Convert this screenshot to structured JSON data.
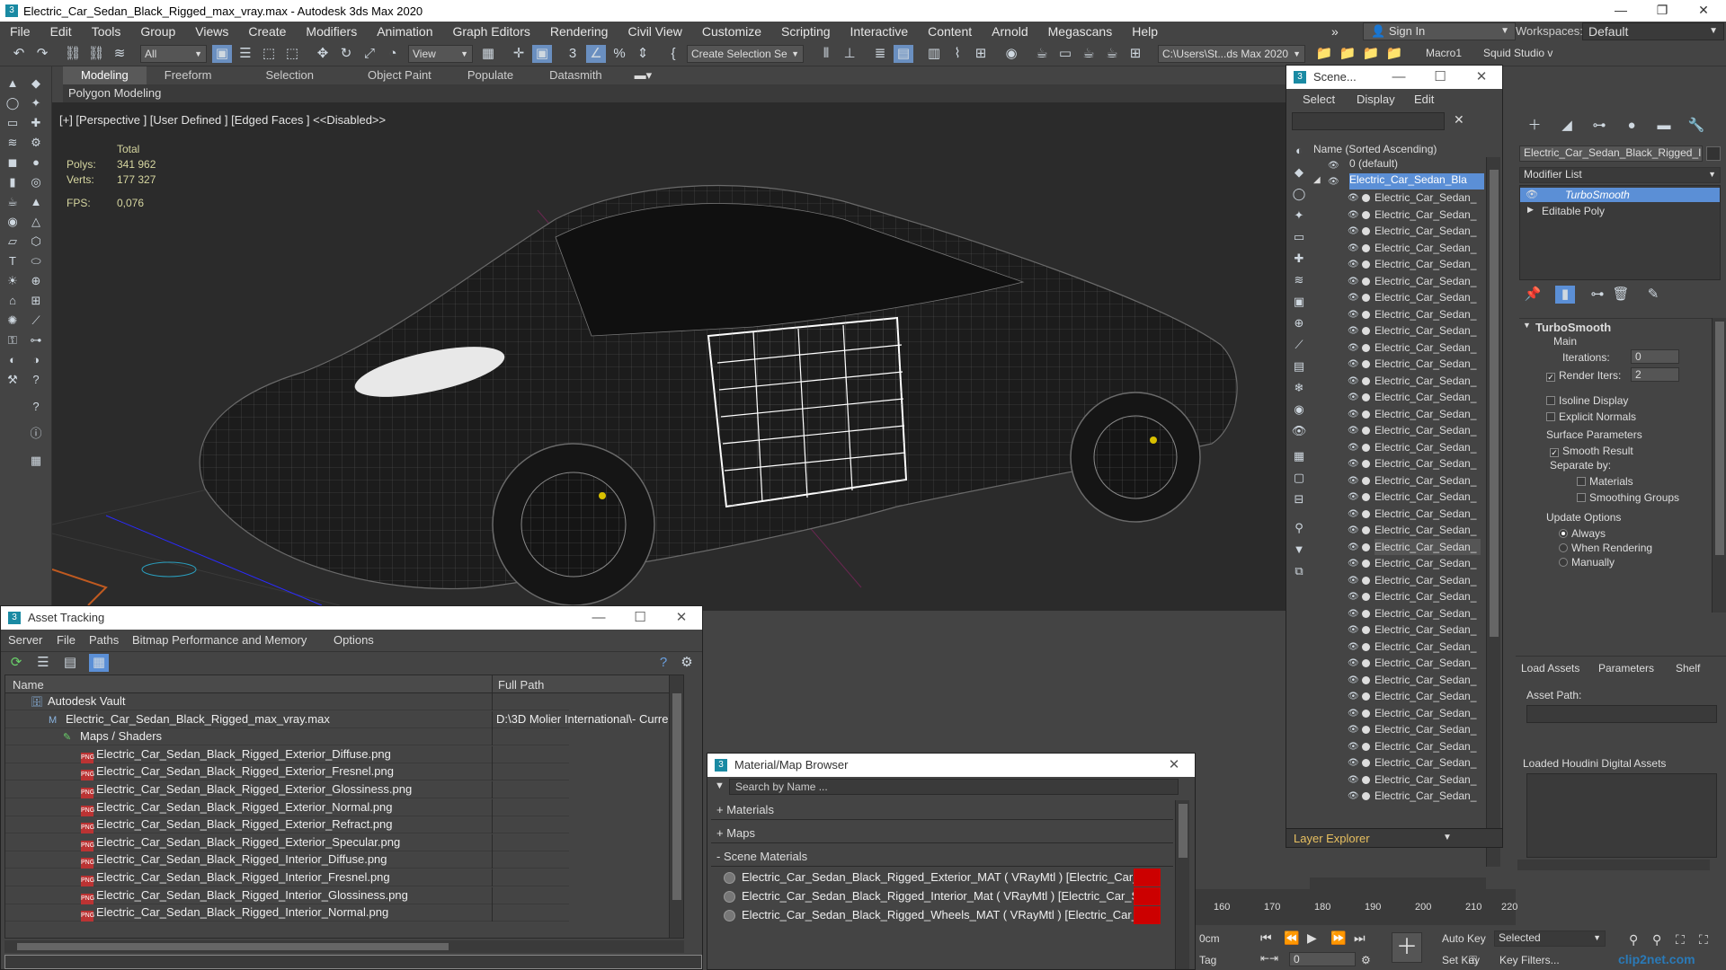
{
  "titlebar": {
    "title": "Electric_Car_Sedan_Black_Rigged_max_vray.max - Autodesk 3ds Max 2020",
    "app_icon": "3",
    "min": "—",
    "max": "❐",
    "close": "✕"
  },
  "menu": [
    "File",
    "Edit",
    "Tools",
    "Group",
    "Views",
    "Create",
    "Modifiers",
    "Animation",
    "Graph Editors",
    "Rendering",
    "Civil View",
    "Customize",
    "Scripting",
    "Interactive",
    "Content",
    "Arnold",
    "Megascans",
    "Help"
  ],
  "menu_more": "»",
  "signin": {
    "label": "Sign In",
    "icon": "user-icon"
  },
  "workspaces": {
    "label": "Workspaces:",
    "value": "Default"
  },
  "toolbar": {
    "filter_value": "All",
    "view_value": "View",
    "selection_set": "Create Selection Se",
    "path": "C:\\Users\\St...ds Max 2020",
    "macro": "Macro1",
    "squid": "Squid Studio v"
  },
  "ribbon": {
    "tabs": [
      "Modeling",
      "Freeform",
      "Selection",
      "Object Paint",
      "Populate",
      "Datasmith"
    ],
    "active": "Modeling",
    "sub": "Polygon Modeling"
  },
  "viewport": {
    "label": "[+] [Perspective ] [User Defined ] [Edged Faces ]  <<Disabled>>",
    "total_label": "Total",
    "polys_label": "Polys:",
    "polys_value": "341 962",
    "verts_label": "Verts:",
    "verts_value": "177 327",
    "fps_label": "FPS:",
    "fps_value": "0,076"
  },
  "scene": {
    "title": "Scene...",
    "menu": [
      "Select",
      "Display",
      "Edit"
    ],
    "column": "Name (Sorted Ascending)",
    "default_layer": "0 (default)",
    "root": "Electric_Car_Sedan_Bla",
    "child": "Electric_Car_Sedan_",
    "child_count": 37,
    "footer": "Layer Explorer"
  },
  "command_panel": {
    "object_name": "Electric_Car_Sedan_Black_Rigged_I",
    "modifier_list": "Modifier List",
    "stack": [
      "TurboSmooth",
      "Editable Poly"
    ],
    "rollout": "TurboSmooth",
    "main": "Main",
    "iterations_label": "Iterations:",
    "iterations_value": "0",
    "render_iters_label": "Render Iters:",
    "render_iters_value": "2",
    "isoline": "Isoline Display",
    "explicit": "Explicit Normals",
    "surface": "Surface Parameters",
    "smooth": "Smooth Result",
    "separate": "Separate by:",
    "materials": "Materials",
    "smoothing": "Smoothing Groups",
    "update": "Update Options",
    "always": "Always",
    "when_rendering": "When Rendering",
    "manually": "Manually"
  },
  "houdini": {
    "tabs": [
      "Load Assets",
      "Parameters",
      "Shelf"
    ],
    "asset_path": "Asset Path:",
    "loaded": "Loaded Houdini Digital Assets"
  },
  "asset_tracking": {
    "title": "Asset Tracking",
    "menu": [
      "Server",
      "File",
      "Paths",
      "Bitmap Performance and Memory",
      "Options"
    ],
    "col_name": "Name",
    "col_path": "Full Path",
    "rows": [
      {
        "name": "Autodesk Vault",
        "path": "",
        "indent": 1,
        "type": "vault"
      },
      {
        "name": "Electric_Car_Sedan_Black_Rigged_max_vray.max",
        "path": "D:\\3D Molier International\\- Curren",
        "indent": 2,
        "type": "max"
      },
      {
        "name": "Maps / Shaders",
        "path": "",
        "indent": 3,
        "type": "maps"
      },
      {
        "name": "Electric_Car_Sedan_Black_Rigged_Exterior_Diffuse.png",
        "path": "",
        "indent": 4,
        "type": "png"
      },
      {
        "name": "Electric_Car_Sedan_Black_Rigged_Exterior_Fresnel.png",
        "path": "",
        "indent": 4,
        "type": "png"
      },
      {
        "name": "Electric_Car_Sedan_Black_Rigged_Exterior_Glossiness.png",
        "path": "",
        "indent": 4,
        "type": "png"
      },
      {
        "name": "Electric_Car_Sedan_Black_Rigged_Exterior_Normal.png",
        "path": "",
        "indent": 4,
        "type": "png"
      },
      {
        "name": "Electric_Car_Sedan_Black_Rigged_Exterior_Refract.png",
        "path": "",
        "indent": 4,
        "type": "png"
      },
      {
        "name": "Electric_Car_Sedan_Black_Rigged_Exterior_Specular.png",
        "path": "",
        "indent": 4,
        "type": "png"
      },
      {
        "name": "Electric_Car_Sedan_Black_Rigged_Interior_Diffuse.png",
        "path": "",
        "indent": 4,
        "type": "png"
      },
      {
        "name": "Electric_Car_Sedan_Black_Rigged_Interior_Fresnel.png",
        "path": "",
        "indent": 4,
        "type": "png"
      },
      {
        "name": "Electric_Car_Sedan_Black_Rigged_Interior_Glossiness.png",
        "path": "",
        "indent": 4,
        "type": "png"
      },
      {
        "name": "Electric_Car_Sedan_Black_Rigged_Interior_Normal.png",
        "path": "",
        "indent": 4,
        "type": "png"
      }
    ]
  },
  "material_browser": {
    "title": "Material/Map Browser",
    "search": "Search by Name ...",
    "sections": [
      "+ Materials",
      "+ Maps",
      "- Scene Materials"
    ],
    "materials": [
      "Electric_Car_Sedan_Black_Rigged_Exterior_MAT  ( VRayMtl )  [Electric_Car_Seda...",
      "Electric_Car_Sedan_Black_Rigged_Interior_Mat  ( VRayMtl )  [Electric_Car_Sedan...",
      "Electric_Car_Sedan_Black_Rigged_Wheels_MAT  ( VRayMtl )  [Electric_Car_Seda..."
    ]
  },
  "timeline": {
    "ticks": [
      "160",
      "170",
      "180",
      "190",
      "200",
      "210",
      "220"
    ]
  },
  "bottom": {
    "unit": "0cm",
    "tag": "Tag",
    "frame": "0",
    "auto_key": "Auto Key",
    "set_key": "Set Key",
    "selected": "Selected",
    "key_filters": "Key Filters...",
    "watermark": "clip2net.com"
  },
  "colors": {
    "accent": "#6aa0e0",
    "selection": "#5b8fd6",
    "wire": "#8a8a8a",
    "highlight_wire": "#ffffff",
    "mat_red": "#cc0000",
    "layer_explorer": "#e8c060"
  }
}
